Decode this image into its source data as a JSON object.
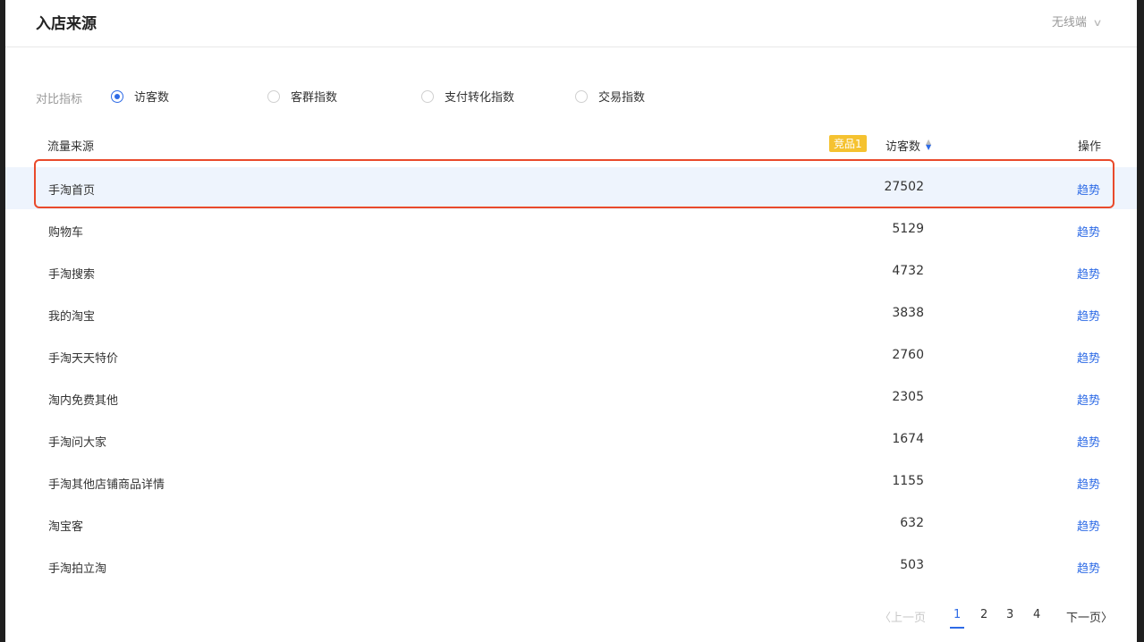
{
  "header": {
    "title": "入店来源",
    "device": "无线端"
  },
  "metrics": {
    "label": "对比指标",
    "options": [
      {
        "label": "访客数",
        "checked": true
      },
      {
        "label": "客群指数",
        "checked": false
      },
      {
        "label": "支付转化指数",
        "checked": false
      },
      {
        "label": "交易指数",
        "checked": false
      }
    ]
  },
  "table": {
    "headers": {
      "source": "流量来源",
      "competitor_badge": "竞品1",
      "visitors": "访客数",
      "ops": "操作"
    },
    "rows": [
      {
        "source": "手淘首页",
        "visitors": "27502",
        "action": "趋势"
      },
      {
        "source": "购物车",
        "visitors": "5129",
        "action": "趋势"
      },
      {
        "source": "手淘搜索",
        "visitors": "4732",
        "action": "趋势"
      },
      {
        "source": "我的淘宝",
        "visitors": "3838",
        "action": "趋势"
      },
      {
        "source": "手淘天天特价",
        "visitors": "2760",
        "action": "趋势"
      },
      {
        "source": "淘内免费其他",
        "visitors": "2305",
        "action": "趋势"
      },
      {
        "source": "手淘问大家",
        "visitors": "1674",
        "action": "趋势"
      },
      {
        "source": "手淘其他店铺商品详情",
        "visitors": "1155",
        "action": "趋势"
      },
      {
        "source": "淘宝客",
        "visitors": "632",
        "action": "趋势"
      },
      {
        "source": "手淘拍立淘",
        "visitors": "503",
        "action": "趋势"
      }
    ]
  },
  "pagination": {
    "prev": "〈上一页",
    "pages": [
      "1",
      "2",
      "3",
      "4"
    ],
    "current": "1",
    "next": "下一页〉"
  }
}
